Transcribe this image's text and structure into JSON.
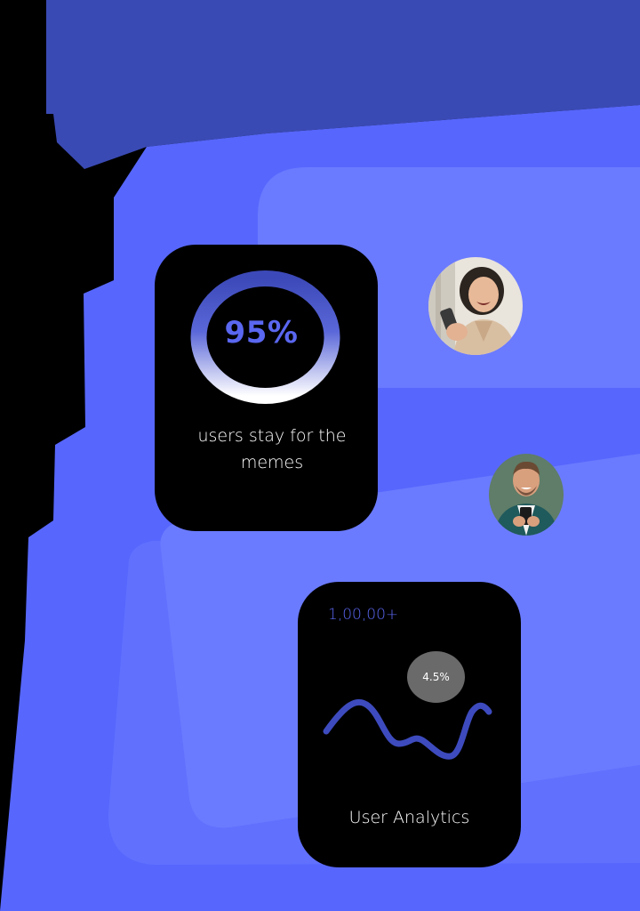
{
  "retention_card": {
    "percent_label": "95%",
    "caption": "users stay for the memes"
  },
  "analytics_card": {
    "count_label": "1,00,00+",
    "badge_label": "4.5%",
    "title": "User Analytics"
  },
  "avatars": [
    {
      "name": "woman-laughing-avatar"
    },
    {
      "name": "man-smiling-avatar"
    }
  ],
  "colors": {
    "accent": "#5A67F0",
    "background_deep": "#3A4AB4",
    "background_main": "#5767FD",
    "background_panel": "#6B7BFF",
    "card": "#000000",
    "badge": "#6a6a6a",
    "wave": "#3D4BBE"
  },
  "icons": [
    "progress-ring-icon",
    "trend-wave-icon"
  ]
}
